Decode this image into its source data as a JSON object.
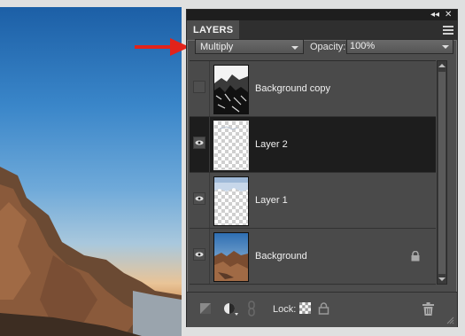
{
  "panel": {
    "title": "LAYERS",
    "collapse_glyph": "◂◂",
    "close_glyph": "✕",
    "blend_mode": "Multiply",
    "opacity_label": "Opacity:",
    "opacity_value": "100%"
  },
  "layers": [
    {
      "name": "Background copy",
      "visible": false,
      "selected": false,
      "thumb": "texture",
      "locked": false
    },
    {
      "name": "Layer 2",
      "visible": true,
      "selected": true,
      "thumb": "transparent",
      "locked": false
    },
    {
      "name": "Layer 1",
      "visible": true,
      "selected": false,
      "thumb": "sky",
      "locked": false
    },
    {
      "name": "Background",
      "visible": true,
      "selected": false,
      "thumb": "photo",
      "locked": true
    }
  ],
  "footer": {
    "lock_label": "Lock:"
  },
  "icons": [
    "arrow-annotation",
    "eye-icon",
    "lock-icon",
    "new-layer-icon",
    "adjustment-icon",
    "link-icon",
    "lock-transparent-icon",
    "lock-all-icon",
    "trash-icon",
    "panel-menu-icon"
  ],
  "colors": {
    "panel": "#4d4d4d",
    "selected_row": "#1d1d1d",
    "arrow": "#e2231a"
  }
}
